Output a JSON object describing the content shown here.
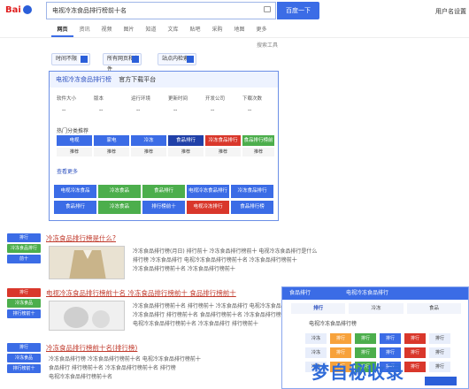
{
  "header": {
    "logo_text": "Bai",
    "search_query": "电视冷冻食品排行榜前十名",
    "search_button": "百度一下",
    "user_link": "用户名",
    "settings_link": "设置"
  },
  "tabs": [
    "网页",
    "资讯",
    "视频",
    "图片",
    "知道",
    "文库",
    "贴吧",
    "采购",
    "地图",
    "更多"
  ],
  "tools_link": "搜索工具",
  "pills": [
    "时间不限",
    "所有网页和文件",
    "站点内检索"
  ],
  "software_card": {
    "title": "电视冷冻食品排行榜",
    "subtitle": "官方下载平台",
    "stats": [
      {
        "label": "软件大小",
        "value": "--"
      },
      {
        "label": "版本",
        "value": "--"
      },
      {
        "label": "运行环境",
        "value": "--"
      },
      {
        "label": "更新时间",
        "value": "--"
      },
      {
        "label": "开发公司",
        "value": "--"
      },
      {
        "label": "下载次数",
        "value": "--"
      }
    ],
    "section_label": "热门分类推荐",
    "categories": [
      {
        "label": "电视",
        "color": "#3b6ce6"
      },
      {
        "label": "家电",
        "color": "#3b6ce6"
      },
      {
        "label": "冷冻",
        "color": "#3b6ce6"
      },
      {
        "label": "食品排行",
        "color": "#2040a8"
      },
      {
        "label": "冷冻食品排行",
        "color": "#d9372b"
      },
      {
        "label": "食品排行榜前十",
        "color": "#4cae4c"
      }
    ],
    "sub_labels": [
      "推荐",
      "推荐",
      "推荐",
      "推荐",
      "推荐",
      "推荐"
    ],
    "more_link": "查看更多",
    "downloads_row1": [
      {
        "label": "电视冷冻食品",
        "color": "#3b6ce6"
      },
      {
        "label": "冷冻食品",
        "color": "#4cae4c"
      },
      {
        "label": "食品排行",
        "color": "#4cae4c"
      },
      {
        "label": "电视冷冻食品排行",
        "color": "#3b6ce6"
      },
      {
        "label": "冷冻食品排行",
        "color": "#3b6ce6"
      }
    ],
    "downloads_row2": [
      {
        "label": "食品排行",
        "color": "#3b6ce6"
      },
      {
        "label": "冷冻食品",
        "color": "#4cae4c"
      },
      {
        "label": "排行榜前十",
        "color": "#3b6ce6"
      },
      {
        "label": "电视冷冻排行",
        "color": "#d9372b"
      },
      {
        "label": "食品排行榜",
        "color": "#3b6ce6"
      }
    ]
  },
  "results": [
    {
      "title": "冷冻食品排行榜是什么?",
      "badges": [
        {
          "label": "排行",
          "color": "#3b6ce6"
        },
        {
          "label": "冷冻食品排行",
          "color": "#4cae4c"
        },
        {
          "label": "前十",
          "color": "#3b6ce6"
        }
      ],
      "snippets": [
        "冷冻食品排行榜(月日) 排行前十 冷冻食品排行榜前十 电视冷冻食品排行是什么",
        "排行榜 冷冻食品排行 电视冷冻食品排行榜前十名 冷冻食品排行榜前十",
        "冷冻食品排行榜前十名 冷冻食品排行榜前十"
      ]
    },
    {
      "title": "电视冷冻食品排行榜前十名 冷冻食品排行榜前十 食品排行榜前十",
      "badges": [
        {
          "label": "排行",
          "color": "#d9372b"
        },
        {
          "label": "冷冻食品",
          "color": "#4cae4c"
        },
        {
          "label": "排行榜前十",
          "color": "#3b6ce6"
        }
      ],
      "snippets": [
        "冷冻食品排行榜前十名 排行榜前十 冷冻食品排行 电视冷冻食品排行榜",
        "冷冻食品排行 排行榜前十名 食品排行榜前十名 冷冻食品排行榜前十名",
        "电视冷冻食品排行榜前十名 冷冻食品排行 排行榜前十"
      ]
    },
    {
      "title": "冷冻食品排行榜前十名(排行榜)",
      "badges": [
        {
          "label": "排行",
          "color": "#3b6ce6"
        },
        {
          "label": "冷冻食品",
          "color": "#3b6ce6"
        },
        {
          "label": "排行榜前十",
          "color": "#3b6ce6"
        }
      ],
      "snippets": [
        "冷冻食品排行榜 冷冻食品排行榜前十名 电视冷冻食品排行榜前十",
        "食品排行 排行榜前十名 冷冻食品排行榜前十名 排行榜",
        "电视冷冻食品排行榜前十名"
      ]
    }
  ],
  "popup": {
    "header": "食品排行",
    "header_right": "电视冷冻食品排行",
    "tabs": [
      "排行",
      "冷冻",
      "食品"
    ],
    "line": "电视冷冻食品排行榜",
    "rows": [
      [
        "冷冻",
        "排行",
        "排行",
        "排行",
        "排行",
        "排行"
      ],
      [
        "冷冻",
        "排行",
        "排行",
        "排行",
        "排行",
        "排行"
      ],
      [
        "冷冻",
        "排行",
        "排行",
        "排行",
        "排行",
        "排行"
      ]
    ]
  },
  "watermark": "梦自秘收录"
}
